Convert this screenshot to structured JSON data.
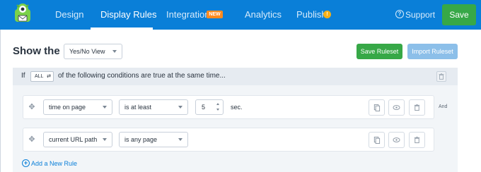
{
  "colors": {
    "brand_blue": "#0a7fd8",
    "save_green": "#37a847",
    "new_badge": "#ff8a1f",
    "publish_badge": "#f5b017",
    "import_disabled": "#8cbfe9"
  },
  "nav": {
    "logo_icon": "monster-logo-icon",
    "tabs": [
      {
        "label": "Design"
      },
      {
        "label": "Display Rules"
      },
      {
        "label": "Integrations",
        "badge": "NEW"
      },
      {
        "label": "Analytics"
      },
      {
        "label": "Publish",
        "badge": "!"
      }
    ],
    "support_label": "Support",
    "save_label": "Save"
  },
  "view": {
    "heading": "Show the",
    "selected_view": "Yes/No View",
    "save_ruleset_label": "Save Ruleset",
    "import_ruleset_label": "Import Ruleset"
  },
  "ruleset": {
    "if_label": "If",
    "match_mode": "ALL",
    "condition_text": "of the following conditions are true at the same time...",
    "rules": [
      {
        "field": "time on page",
        "operator": "is at least",
        "value": "5",
        "unit": "sec.",
        "connector": "And"
      },
      {
        "field": "current URL path",
        "operator": "is any page"
      }
    ],
    "add_rule_label": "Add a New Rule"
  }
}
